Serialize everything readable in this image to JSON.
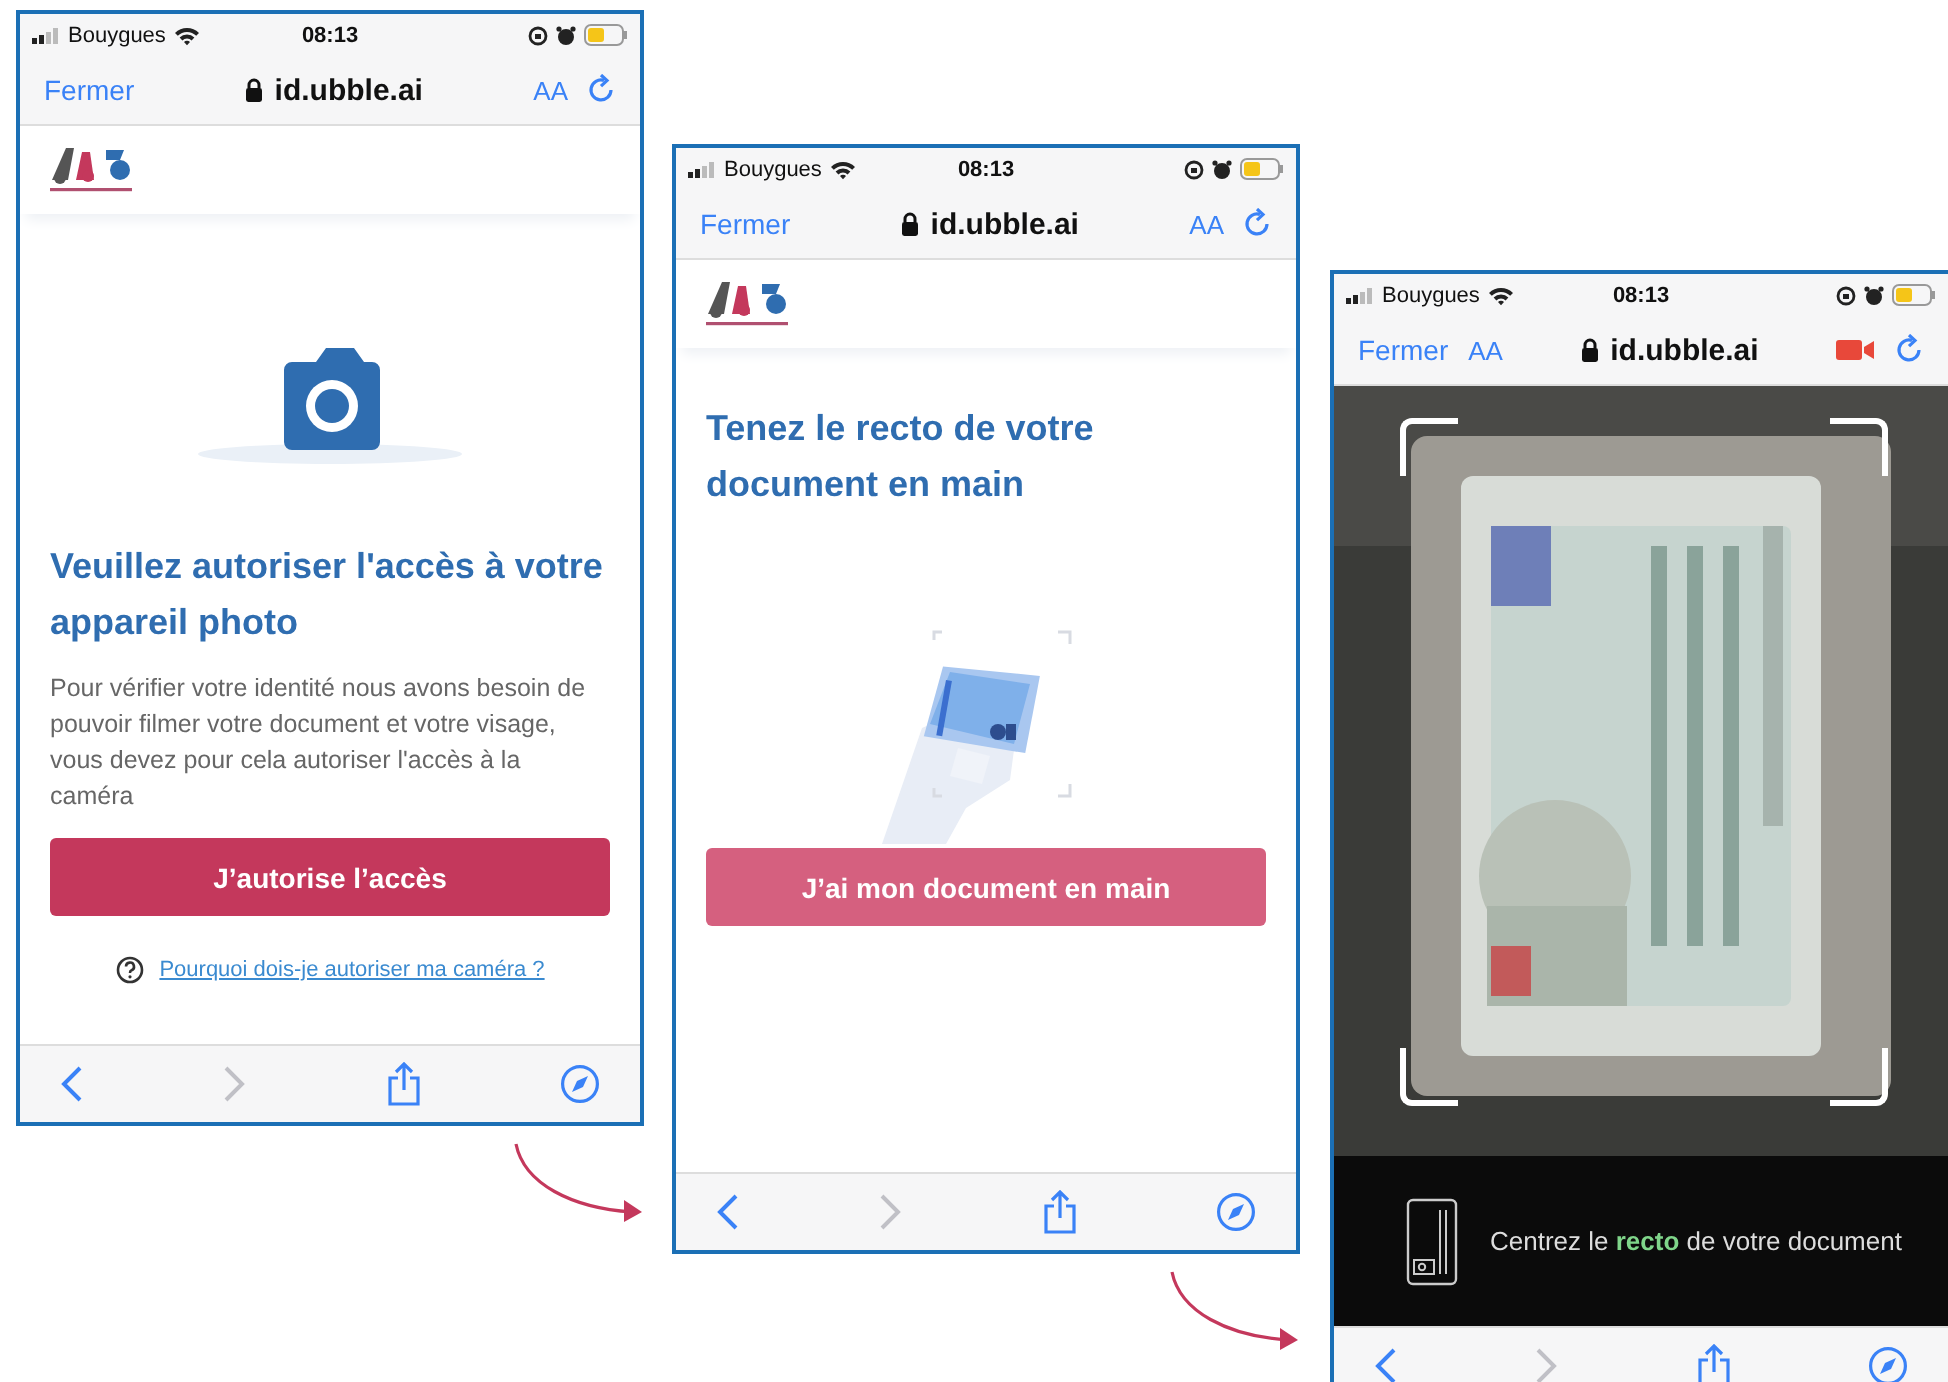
{
  "screens": [
    {
      "kind": "permission",
      "status_bar": {
        "carrier": "Bouygues",
        "time": "08:13"
      },
      "browser_bar": {
        "close": "Fermer",
        "url": "id.ubble.ai",
        "text_size": "AA",
        "recording": false
      },
      "title": "Veuillez autoriser l'accès à votre appareil photo",
      "text": "Pour vérifier votre identité nous avons besoin de pouvoir filmer votre document et votre visage, vous devez pour cela autoriser l'accès à la caméra",
      "button": {
        "label": "J’autorise l’accès",
        "disabled": false
      },
      "link": "Pourquoi dois-je autoriser ma caméra ?"
    },
    {
      "kind": "document",
      "status_bar": {
        "carrier": "Bouygues",
        "time": "08:13"
      },
      "browser_bar": {
        "close": "Fermer",
        "url": "id.ubble.ai",
        "text_size": "AA",
        "recording": false
      },
      "title": "Tenez le recto de votre document en main",
      "button": {
        "label": "J’ai mon document en main",
        "disabled": true
      }
    },
    {
      "kind": "scanner",
      "status_bar": {
        "carrier": "Bouygues",
        "time": "08:13"
      },
      "browser_bar": {
        "close": "Fermer",
        "url": "id.ubble.ai",
        "text_size": "AA",
        "recording": true
      },
      "instruction": "Centrez le **recto** de votre document"
    }
  ]
}
